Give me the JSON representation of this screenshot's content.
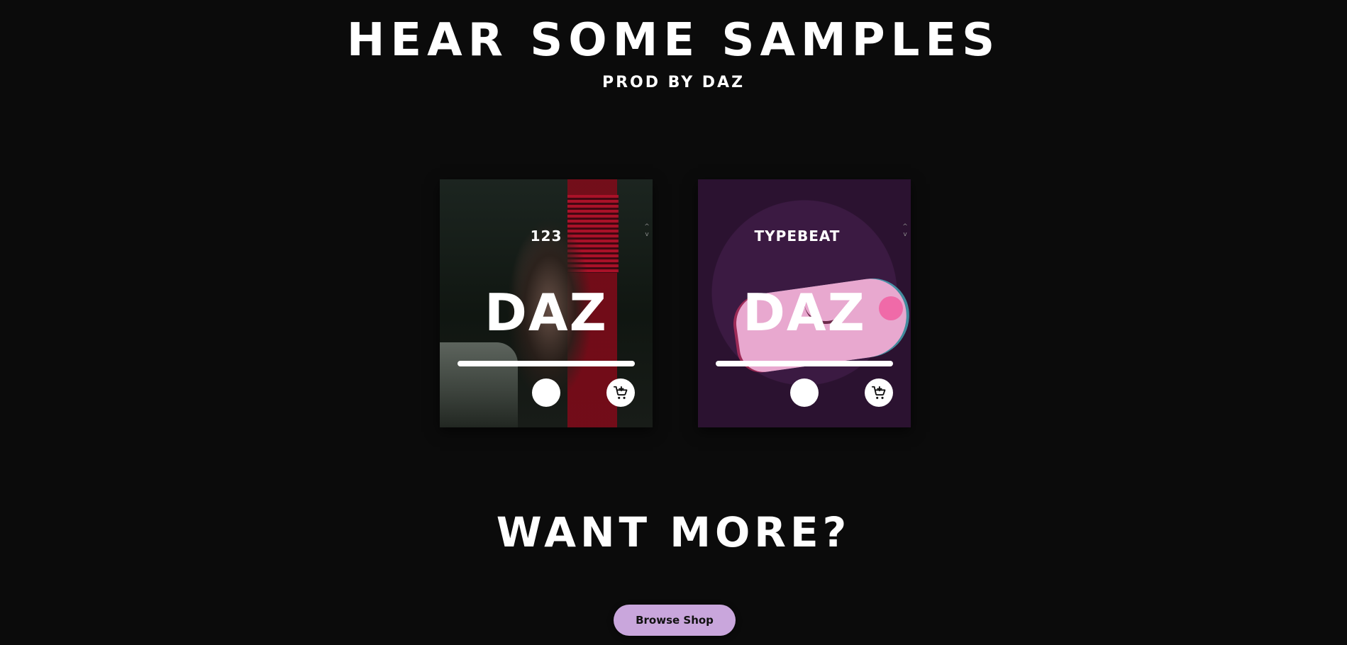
{
  "header": {
    "title": "HEAR SOME SAMPLES",
    "subtitle": "PROD BY DAZ"
  },
  "cards": [
    {
      "top_label": "123",
      "title": "DAZ",
      "scroll_up": "^",
      "scroll_down": "v",
      "play_icon": "play-icon",
      "cart_icon": "cart-add-icon"
    },
    {
      "top_label": "TYPEBEAT",
      "title": "DAZ",
      "scroll_up": "^",
      "scroll_down": "v",
      "play_icon": "play-icon",
      "cart_icon": "cart-add-icon"
    }
  ],
  "cta": {
    "heading": "WANT MORE?",
    "button_label": "Browse Shop"
  },
  "colors": {
    "background": "#0b0b0b",
    "text": "#ffffff",
    "button": "#c9a6dc"
  }
}
